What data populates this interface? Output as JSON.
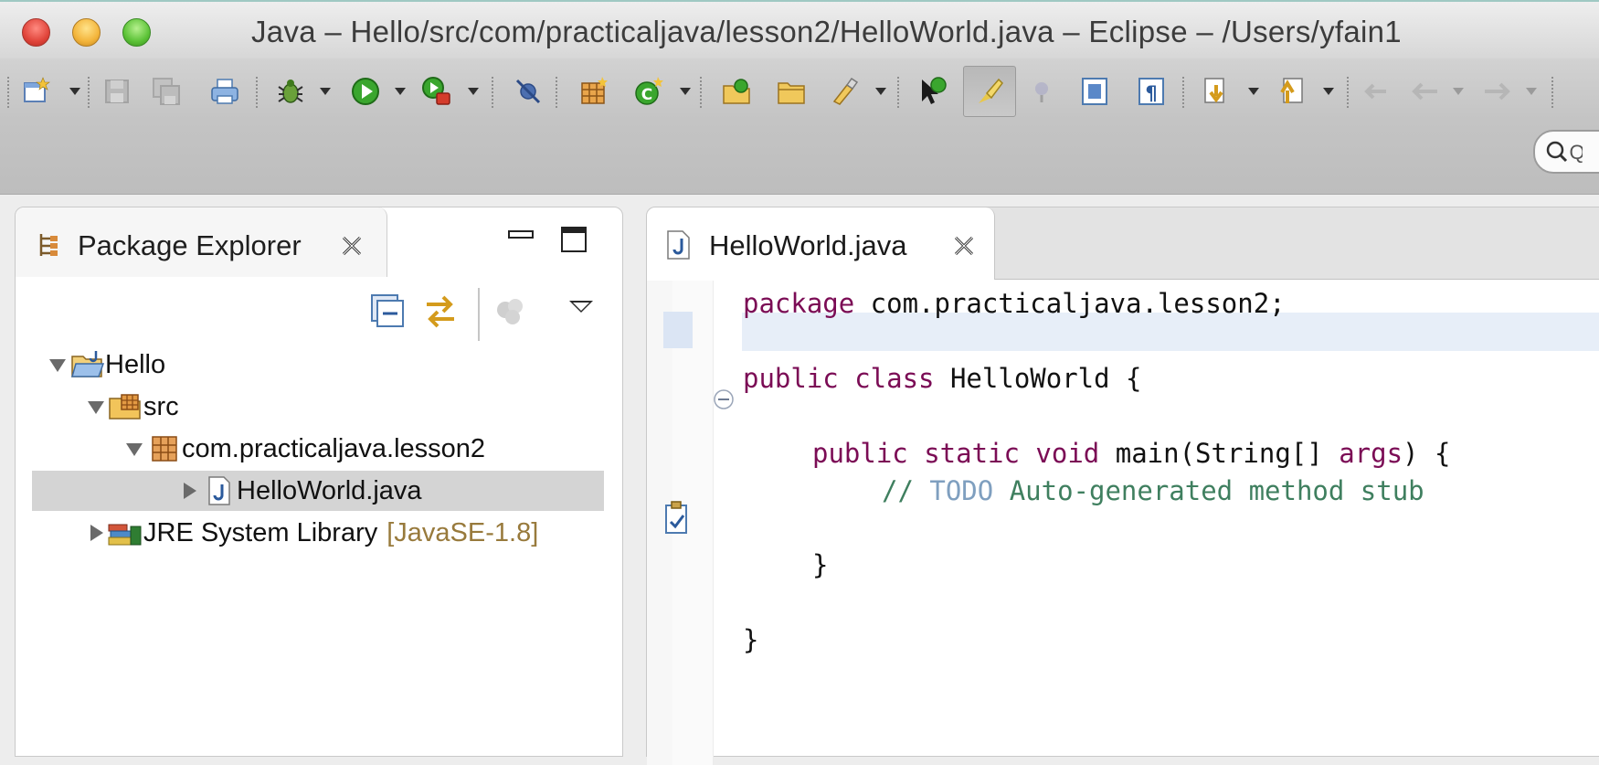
{
  "window": {
    "title": "Java – Hello/src/com/practicaljava/lesson2/HelloWorld.java – Eclipse – /Users/yfain1"
  },
  "colors": {
    "keyword": "#7b0c55",
    "comment": "#3f7f5f",
    "task_tag": "#7f9fbf",
    "library_decoration": "#987a3c",
    "current_line": "#e7eef8",
    "selection": "#d4d4d4"
  },
  "toolbar": {
    "buttons": [
      "new-icon",
      "save-icon",
      "save-all-icon",
      "print-icon",
      "debug-icon",
      "run-icon",
      "run-external-tools-icon",
      "skip-breakpoints-icon",
      "new-java-package-icon",
      "new-java-class-icon",
      "open-type-icon",
      "open-folder-icon",
      "search-icon",
      "open-task-icon",
      "toggle-mark-occurrences-icon",
      "toggle-breadcrumb-icon",
      "toggle-block-selection-icon",
      "show-whitespace-icon",
      "next-annotation-icon",
      "previous-annotation-icon",
      "last-edit-location-icon",
      "back-icon",
      "forward-icon"
    ],
    "search_placeholder": "Q"
  },
  "package_explorer": {
    "tab_label": "Package Explorer",
    "tree": [
      {
        "label": "Hello",
        "expanded": true,
        "icon": "java-project-icon"
      },
      {
        "label": "src",
        "expanded": true,
        "icon": "source-folder-icon"
      },
      {
        "label": "com.practicaljava.lesson2",
        "expanded": true,
        "icon": "package-icon"
      },
      {
        "label": "HelloWorld.java",
        "expanded": false,
        "icon": "java-file-icon",
        "selected": true
      },
      {
        "label": "JRE System Library",
        "decoration": "[JavaSE-1.8]",
        "expanded": false,
        "icon": "library-icon"
      }
    ]
  },
  "editor": {
    "tab_label": "HelloWorld.java",
    "code": {
      "line1_kw": "package",
      "line1_rest": " com.practicaljava.lesson2;",
      "line2_kw": "public class",
      "line2_rest": " HelloWorld {",
      "line3_kw": "public static void",
      "line3_rest": " main(String[] ",
      "line3_param": "args",
      "line3_end": ") {",
      "line4_slash": "// ",
      "line4_todo": "TODO",
      "line4_text": " Auto-generated method stub",
      "line5": "}",
      "line6": "}"
    }
  }
}
